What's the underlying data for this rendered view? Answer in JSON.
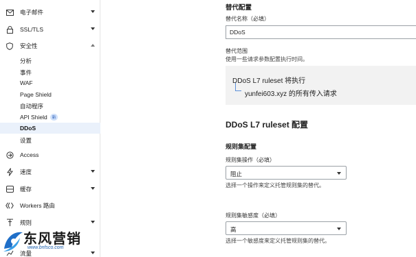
{
  "sidebar": {
    "nav": [
      {
        "label": "电子邮件",
        "icon": "mail-icon"
      },
      {
        "label": "SSL/TLS",
        "icon": "lock-icon"
      },
      {
        "label": "安全性",
        "icon": "shield-icon"
      }
    ],
    "security_sub": [
      {
        "label": "分析"
      },
      {
        "label": "事件"
      },
      {
        "label": "WAF"
      },
      {
        "label": "Page Shield"
      },
      {
        "label": "自动程序"
      },
      {
        "label": "API Shield",
        "badge": "新"
      },
      {
        "label": "DDoS"
      },
      {
        "label": "设置"
      }
    ],
    "nav_bottom": [
      {
        "label": "Access",
        "icon": "access-icon"
      },
      {
        "label": "速度",
        "icon": "lightning-icon"
      },
      {
        "label": "缓存",
        "icon": "cache-icon"
      },
      {
        "label": "Workers 路由",
        "icon": "workers-icon"
      },
      {
        "label": "规则",
        "icon": "rules-icon"
      },
      {
        "label": "流量",
        "icon": "traffic-icon"
      }
    ]
  },
  "override": {
    "section_title": "替代配置",
    "name_label": "替代名称（必填）",
    "name_value": "DDoS",
    "scope_label": "替代范围",
    "scope_help": "使用一些请求参数配置执行时间。",
    "scope_line1": "DDoS L7 ruleset 将执行",
    "scope_line2": "yunfei603.xyz 的所有传入请求"
  },
  "ruleset": {
    "title": "DDoS L7 ruleset 配置",
    "subtitle": "规则集配置",
    "action_label": "规则集操作（必填）",
    "action_value": "阻止",
    "action_help": "选择一个操作来定义托管规则集的替代。",
    "sensitivity_label": "规则集敏感度（必填）",
    "sensitivity_value": "高",
    "sensitivity_help": "选择一个敏感度来定义托管规则集的替代。"
  },
  "watermark": {
    "text": "东风营销",
    "url": "www.bnfsco.com"
  }
}
